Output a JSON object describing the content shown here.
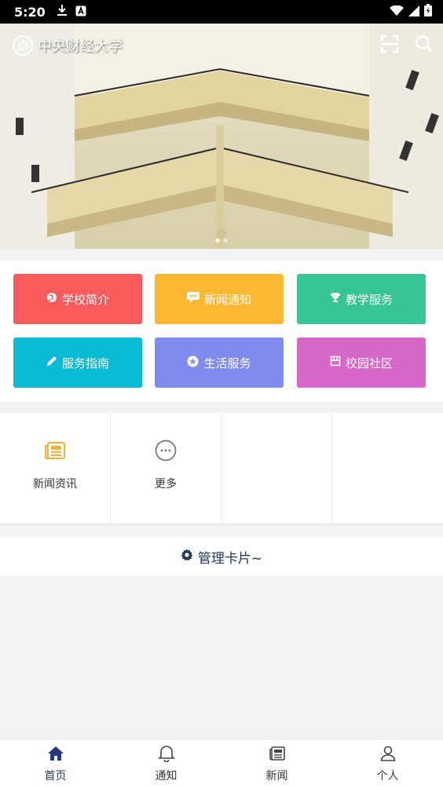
{
  "status_bar": {
    "time": "5:20"
  },
  "header": {
    "school_name": "中央财经大学"
  },
  "carousel": {
    "dots": 2,
    "active_index": 0
  },
  "grid": [
    {
      "label": "学校简介",
      "icon": "globe-icon",
      "color": "#f95b5c"
    },
    {
      "label": "新闻通知",
      "icon": "chat-icon",
      "color": "#fcb832"
    },
    {
      "label": "教学服务",
      "icon": "trophy-icon",
      "color": "#37c595"
    },
    {
      "label": "服务指南",
      "icon": "pencil-icon",
      "color": "#08bcd4"
    },
    {
      "label": "生活服务",
      "icon": "star-circle-icon",
      "color": "#7f8cee"
    },
    {
      "label": "校园社区",
      "icon": "store-icon",
      "color": "#d767c9"
    }
  ],
  "apps": [
    {
      "label": "新闻资讯",
      "icon": "newspaper-icon"
    },
    {
      "label": "更多",
      "icon": "more-icon"
    }
  ],
  "manage": {
    "label": "管理卡片~"
  },
  "tabs": [
    {
      "label": "首页",
      "icon": "home-icon"
    },
    {
      "label": "通知",
      "icon": "bell-icon"
    },
    {
      "label": "新闻",
      "icon": "news-icon"
    },
    {
      "label": "个人",
      "icon": "user-icon"
    }
  ]
}
